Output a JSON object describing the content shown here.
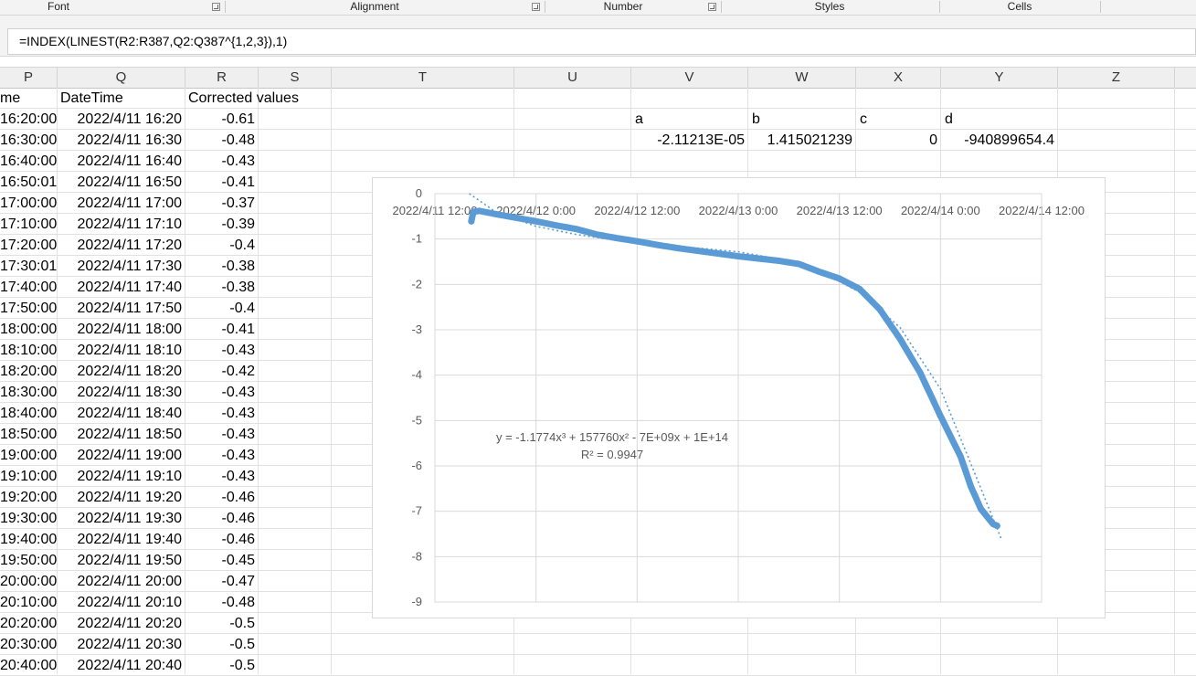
{
  "ribbon": {
    "groups": [
      "Font",
      "Alignment",
      "Number",
      "Styles",
      "Cells"
    ]
  },
  "formula_bar": {
    "formula": "=INDEX(LINEST(R2:R387,Q2:Q387^{1,2,3}),1)"
  },
  "columns": [
    "P",
    "Q",
    "R",
    "S",
    "T",
    "U",
    "V",
    "W",
    "X",
    "Y",
    "Z"
  ],
  "headers": {
    "p": "me",
    "q": "DateTime",
    "r": "Corrected values"
  },
  "rows": [
    {
      "p": "16:20:00",
      "q": "2022/4/11 16:20",
      "r": "-0.61"
    },
    {
      "p": "16:30:00",
      "q": "2022/4/11 16:30",
      "r": "-0.48"
    },
    {
      "p": "16:40:00",
      "q": "2022/4/11 16:40",
      "r": "-0.43"
    },
    {
      "p": "16:50:01",
      "q": "2022/4/11 16:50",
      "r": "-0.41"
    },
    {
      "p": "17:00:00",
      "q": "2022/4/11 17:00",
      "r": "-0.37"
    },
    {
      "p": "17:10:00",
      "q": "2022/4/11 17:10",
      "r": "-0.39"
    },
    {
      "p": "17:20:00",
      "q": "2022/4/11 17:20",
      "r": "-0.4"
    },
    {
      "p": "17:30:01",
      "q": "2022/4/11 17:30",
      "r": "-0.38"
    },
    {
      "p": "17:40:00",
      "q": "2022/4/11 17:40",
      "r": "-0.38"
    },
    {
      "p": "17:50:00",
      "q": "2022/4/11 17:50",
      "r": "-0.4"
    },
    {
      "p": "18:00:00",
      "q": "2022/4/11 18:00",
      "r": "-0.41"
    },
    {
      "p": "18:10:00",
      "q": "2022/4/11 18:10",
      "r": "-0.43"
    },
    {
      "p": "18:20:00",
      "q": "2022/4/11 18:20",
      "r": "-0.42"
    },
    {
      "p": "18:30:00",
      "q": "2022/4/11 18:30",
      "r": "-0.43"
    },
    {
      "p": "18:40:00",
      "q": "2022/4/11 18:40",
      "r": "-0.43"
    },
    {
      "p": "18:50:00",
      "q": "2022/4/11 18:50",
      "r": "-0.43"
    },
    {
      "p": "19:00:00",
      "q": "2022/4/11 19:00",
      "r": "-0.43"
    },
    {
      "p": "19:10:00",
      "q": "2022/4/11 19:10",
      "r": "-0.43"
    },
    {
      "p": "19:20:00",
      "q": "2022/4/11 19:20",
      "r": "-0.46"
    },
    {
      "p": "19:30:00",
      "q": "2022/4/11 19:30",
      "r": "-0.46"
    },
    {
      "p": "19:40:00",
      "q": "2022/4/11 19:40",
      "r": "-0.46"
    },
    {
      "p": "19:50:00",
      "q": "2022/4/11 19:50",
      "r": "-0.45"
    },
    {
      "p": "20:00:00",
      "q": "2022/4/11 20:00",
      "r": "-0.47"
    },
    {
      "p": "20:10:00",
      "q": "2022/4/11 20:10",
      "r": "-0.48"
    },
    {
      "p": "20:20:00",
      "q": "2022/4/11 20:20",
      "r": "-0.5"
    },
    {
      "p": "20:30:00",
      "q": "2022/4/11 20:30",
      "r": "-0.5"
    },
    {
      "p": "20:40:00",
      "q": "2022/4/11 20:40",
      "r": "-0.5"
    }
  ],
  "coefficients": {
    "labels": {
      "a": "a",
      "b": "b",
      "c": "c",
      "d": "d"
    },
    "values": {
      "a": "-2.11213E-05",
      "b": "1.415021239",
      "c": "0",
      "d": "-940899654.4"
    }
  },
  "chart": {
    "colors": {
      "series": "#5b9bd5",
      "grid": "#d9d9d9",
      "axis_text": "#595959"
    },
    "trendline_equation": "y = -1.1774x³ + 157760x² - 7E+09x + 1E+14",
    "trendline_r2": "R² = 0.9947",
    "chart_data": {
      "type": "scatter",
      "x_tick_labels": [
        "2022/4/11 12:00",
        "2022/4/12 0:00",
        "2022/4/12 12:00",
        "2022/4/13 0:00",
        "2022/4/13 12:00",
        "2022/4/14 0:00",
        "2022/4/14 12:00"
      ],
      "x_ticks_days": [
        0,
        0.5,
        1.0,
        1.5,
        2.0,
        2.5,
        3.0
      ],
      "y_tick_labels": [
        "0",
        "-1",
        "-2",
        "-3",
        "-4",
        "-5",
        "-6",
        "-7",
        "-8",
        "-9"
      ],
      "xlim_days": [
        0,
        3.0
      ],
      "ylim": [
        -9,
        0
      ],
      "grid": true,
      "legend": "none",
      "series": [
        {
          "values_key": [
            [
              0.18,
              -0.61
            ],
            [
              0.19,
              -0.4
            ],
            [
              0.22,
              -0.38
            ],
            [
              0.3,
              -0.45
            ],
            [
              0.4,
              -0.53
            ],
            [
              0.5,
              -0.61
            ],
            [
              0.6,
              -0.7
            ],
            [
              0.7,
              -0.78
            ],
            [
              0.8,
              -0.9
            ],
            [
              0.9,
              -0.98
            ],
            [
              1.0,
              -1.05
            ],
            [
              1.1,
              -1.13
            ],
            [
              1.2,
              -1.2
            ],
            [
              1.3,
              -1.26
            ],
            [
              1.4,
              -1.32
            ],
            [
              1.5,
              -1.38
            ],
            [
              1.6,
              -1.43
            ],
            [
              1.7,
              -1.48
            ],
            [
              1.8,
              -1.55
            ],
            [
              1.9,
              -1.72
            ],
            [
              2.0,
              -1.87
            ],
            [
              2.1,
              -2.1
            ],
            [
              2.2,
              -2.55
            ],
            [
              2.3,
              -3.2
            ],
            [
              2.4,
              -3.95
            ],
            [
              2.5,
              -4.9
            ],
            [
              2.6,
              -5.8
            ],
            [
              2.65,
              -6.45
            ],
            [
              2.7,
              -6.95
            ],
            [
              2.76,
              -7.28
            ],
            [
              2.78,
              -7.32
            ]
          ]
        }
      ],
      "trendline": {
        "type": "polynomial",
        "order": 3,
        "values_key": [
          [
            0.17,
            0.0
          ],
          [
            0.3,
            -0.4
          ],
          [
            0.5,
            -0.72
          ],
          [
            0.7,
            -0.9
          ],
          [
            0.9,
            -1.03
          ],
          [
            1.1,
            -1.12
          ],
          [
            1.3,
            -1.2
          ],
          [
            1.5,
            -1.28
          ],
          [
            1.7,
            -1.44
          ],
          [
            1.9,
            -1.7
          ],
          [
            2.1,
            -2.17
          ],
          [
            2.3,
            -2.95
          ],
          [
            2.5,
            -4.3
          ],
          [
            2.7,
            -6.5
          ],
          [
            2.8,
            -7.6
          ]
        ]
      }
    }
  }
}
